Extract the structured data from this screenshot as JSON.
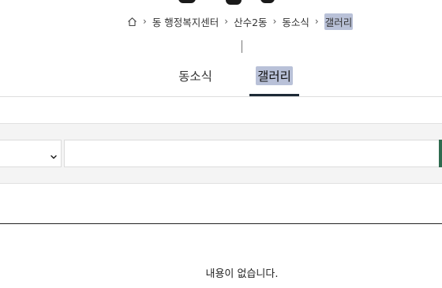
{
  "breadcrumb": {
    "home_icon": "home-icon",
    "items": [
      "동 행정복지센터",
      "산수2동",
      "동소식",
      "갤러리"
    ]
  },
  "tabs": [
    {
      "label": "동소식",
      "active": false
    },
    {
      "label": "갤러리",
      "active": true
    }
  ],
  "filter": {
    "select_value": "",
    "search_value": ""
  },
  "list": {
    "empty_message": "내용이 없습니다."
  },
  "colors": {
    "highlight": "#b9c1d8",
    "tab_underline": "#1d2a36",
    "accent": "#2f6b4f"
  }
}
